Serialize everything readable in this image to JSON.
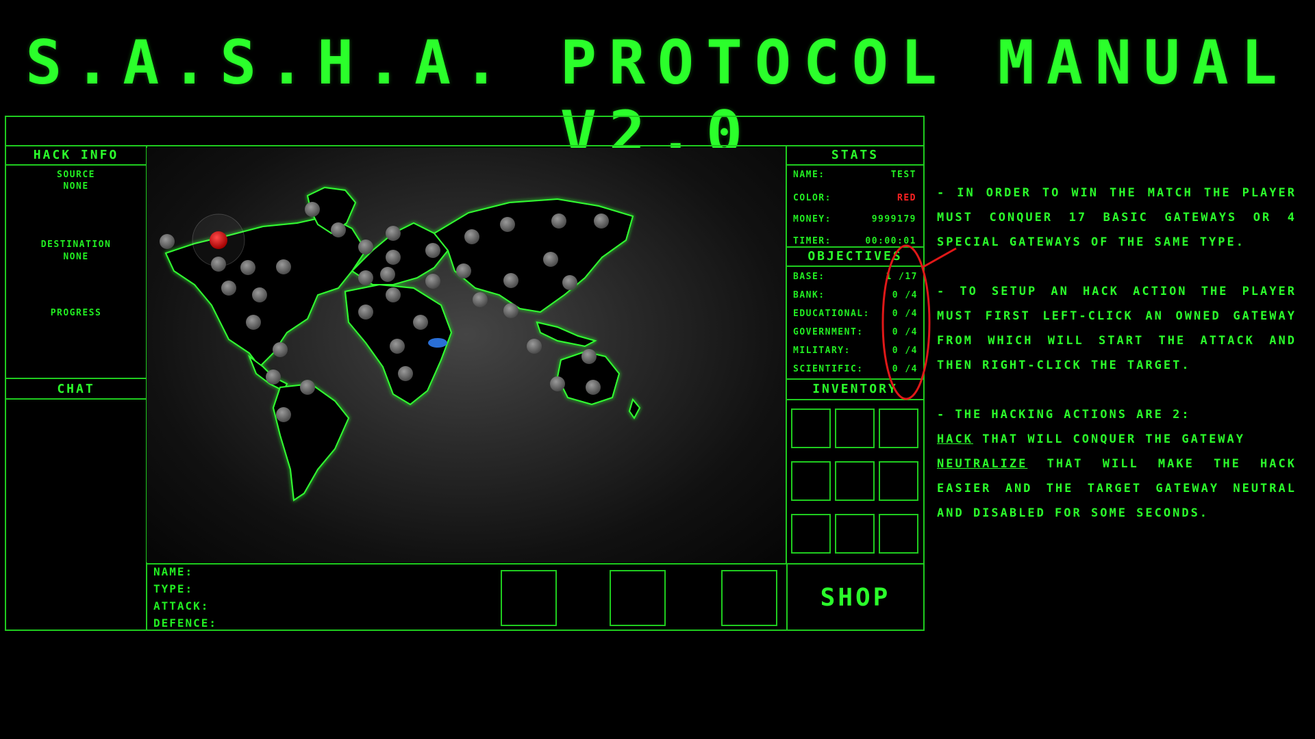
{
  "title": "S.A.S.H.A. PROTOCOL MANUAL V2.0",
  "hack_info": {
    "header": "HACK INFO",
    "source_label": "SOURCE",
    "source_value": "NONE",
    "destination_label": "DESTINATION",
    "destination_value": "NONE",
    "progress_label": "PROGRESS"
  },
  "chat": {
    "header": "CHAT"
  },
  "stats": {
    "header": "STATS",
    "name_label": "NAME:",
    "name_value": "TEST",
    "color_label": "COLOR:",
    "color_value": "RED",
    "money_label": "MONEY:",
    "money_value": "9999179",
    "timer_label": "TIMER:",
    "timer_value": "00:00:01"
  },
  "objectives": {
    "header": "OBJECTIVES",
    "items": [
      {
        "label": "BASE:",
        "value": "1 /17"
      },
      {
        "label": "BANK:",
        "value": "0 /4"
      },
      {
        "label": "EDUCATIONAL:",
        "value": "0 /4"
      },
      {
        "label": "GOVERNMENT:",
        "value": "0 /4"
      },
      {
        "label": "MILITARY:",
        "value": "0 /4"
      },
      {
        "label": "SCIENTIFIC:",
        "value": "0 /4"
      }
    ]
  },
  "inventory": {
    "header": "INVENTORY"
  },
  "selection": {
    "name_label": "NAME:",
    "type_label": "TYPE:",
    "attack_label": "ATTACK:",
    "defence_label": "DEFENCE:"
  },
  "shop": {
    "label": "SHOP"
  },
  "instructions": {
    "p1": "- IN ORDER TO WIN THE MATCH THE PLAYER MUST CONQUER 17 BASIC GATEWAYS OR 4 SPECIAL GATEWAYS OF THE SAME TYPE.",
    "p2": "- TO SETUP AN HACK ACTION THE PLAYER MUST FIRST LEFT-CLICK AN OWNED GATEWAY FROM WHICH WILL START THE ATTACK AND THEN RIGHT-CLICK THE TARGET.",
    "p3": "- THE HACKING ACTIONS ARE 2:",
    "hack_word": "HACK",
    "hack_desc": "THAT WILL CONQUER THE GATEWAY",
    "neutralize_word": "NEUTRALIZE",
    "neutralize_desc": "THAT WILL MAKE THE HACK EASIER AND THE TARGET GATEWAY NEUTRAL AND DISABLED FOR SOME SECONDS."
  },
  "colors": {
    "accent": "#22ee22",
    "player_red": "#ff2222",
    "annotation": "#e01818"
  }
}
